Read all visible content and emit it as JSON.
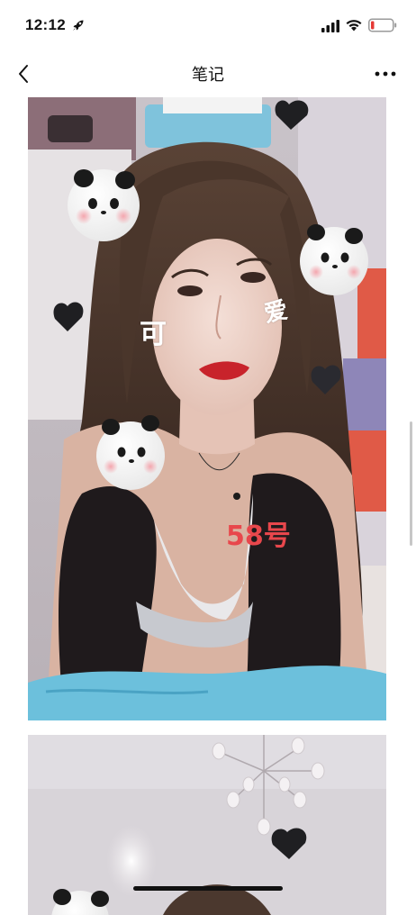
{
  "status_bar": {
    "time": "12:12",
    "icons": [
      "rocket-icon",
      "signal-icon",
      "wifi-icon",
      "battery-low-icon"
    ],
    "battery_color": "#e53935"
  },
  "nav": {
    "title": "笔记",
    "back_icon": "chevron-left-icon",
    "more_icon": "more-dots-icon"
  },
  "photos": [
    {
      "stickers": [
        "可",
        "爱"
      ],
      "caption": "58号",
      "caption_color": "#e8474c",
      "decorations": [
        "panda-sticker",
        "panda-sticker",
        "panda-sticker",
        "heart-sticker",
        "heart-sticker",
        "heart-sticker",
        "heart-sticker"
      ]
    },
    {
      "decorations": [
        "chandelier",
        "panda-sticker",
        "heart-sticker"
      ]
    }
  ]
}
